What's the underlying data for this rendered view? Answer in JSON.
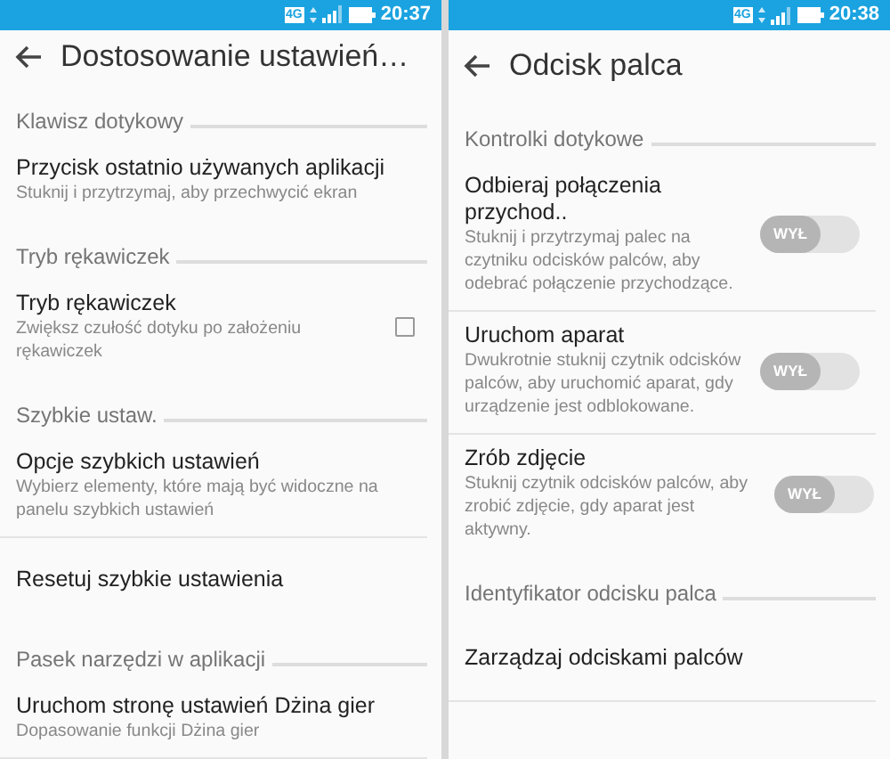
{
  "screens": [
    {
      "status_bar": {
        "network": "4G",
        "time": "20:37"
      },
      "title": "Dostosowanie ustawień…",
      "sections": [
        {
          "header": "Klawisz dotykowy",
          "items": [
            {
              "kind": "plain",
              "title": "Przycisk ostatnio używanych aplikacji",
              "subtitle": "Stuknij i przytrzymaj, aby przechwycić ekran"
            }
          ]
        },
        {
          "header": "Tryb rękawiczek",
          "items": [
            {
              "kind": "checkbox",
              "title": "Tryb rękawiczek",
              "subtitle": "Zwiększ czułość dotyku po założeniu rękawiczek",
              "checked": false
            }
          ]
        },
        {
          "header": "Szybkie ustaw.",
          "items": [
            {
              "kind": "plain",
              "title": "Opcje szybkich ustawień",
              "subtitle": "Wybierz elementy, które mają być widoczne na panelu szybkich ustawień"
            },
            {
              "kind": "plain",
              "title": "Resetuj szybkie ustawienia"
            }
          ]
        },
        {
          "header": "Pasek narzędzi w aplikacji",
          "items": [
            {
              "kind": "plain",
              "title": "Uruchom stronę ustawień Dżina gier",
              "subtitle": "Dopasowanie funkcji Dżina gier"
            }
          ]
        }
      ]
    },
    {
      "status_bar": {
        "network": "4G",
        "time": "20:38"
      },
      "title": "Odcisk palca",
      "sections": [
        {
          "header": "Kontrolki dotykowe",
          "items": [
            {
              "kind": "switch",
              "title": "Odbieraj połączenia przychod..",
              "subtitle": "Stuknij i przytrzymaj palec na czytniku odcisków palców, aby odebrać połączenie przychodzące.",
              "on": false,
              "switch_label": "WYŁ"
            },
            {
              "kind": "switch",
              "title": "Uruchom aparat",
              "subtitle": "Dwukrotnie stuknij czytnik odcisków palców, aby uruchomić aparat, gdy urządzenie jest odblokowane.",
              "on": false,
              "switch_label": "WYŁ"
            },
            {
              "kind": "switch",
              "title": "Zrób zdjęcie",
              "subtitle": "Stuknij czytnik odcisków palców, aby zrobić zdjęcie, gdy aparat jest aktywny.",
              "on": false,
              "switch_label": "WYŁ"
            }
          ]
        },
        {
          "header": "Identyfikator odcisku palca",
          "items": [
            {
              "kind": "plain",
              "title": "Zarządzaj odciskami palców"
            }
          ]
        }
      ]
    }
  ]
}
